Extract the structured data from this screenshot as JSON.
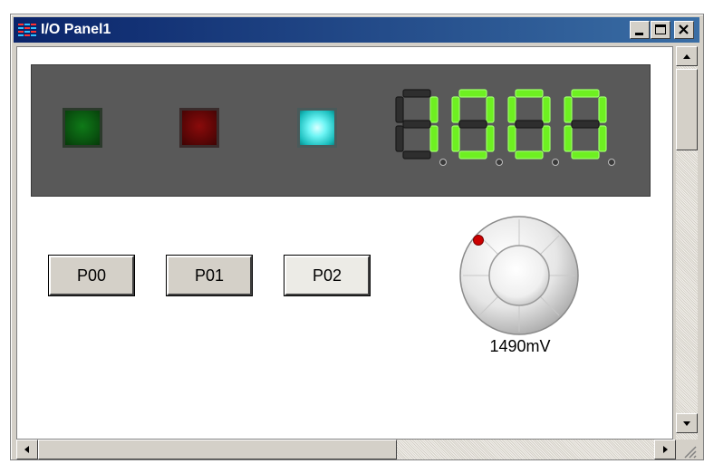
{
  "window": {
    "title": "I/O Panel1",
    "icon": "io-panel-app-icon",
    "controls": [
      "minimize-icon",
      "maximize-icon",
      "close-icon"
    ]
  },
  "display_panel": {
    "leds": [
      {
        "name": "led-1",
        "state": "off",
        "color": "#0a5510"
      },
      {
        "name": "led-2",
        "state": "off",
        "color": "#5e0606"
      },
      {
        "name": "led-3",
        "state": "on",
        "color": "#6ff5f5"
      }
    ],
    "seven_segment": {
      "digits": 4,
      "lit_segments": [
        [
          "b",
          "c"
        ],
        [
          "a",
          "b",
          "c",
          "d",
          "e",
          "f"
        ],
        [
          "a",
          "b",
          "c",
          "d",
          "e",
          "f"
        ],
        [
          "a",
          "b",
          "c",
          "d",
          "e",
          "f"
        ]
      ],
      "lit_color": "#6ef021",
      "unlit_color": "#2e2e2e"
    }
  },
  "buttons": [
    {
      "label": "P00"
    },
    {
      "label": "P01"
    },
    {
      "label": "P02"
    }
  ],
  "knob": {
    "readout": "1490mV",
    "indicator_color": "#cc0000"
  },
  "scrollbars": {
    "vertical": {
      "up_icon": "scroll-up-arrow-icon",
      "down_icon": "scroll-down-arrow-icon"
    },
    "horizontal": {
      "left_icon": "scroll-left-arrow-icon",
      "right_icon": "scroll-right-arrow-icon"
    }
  }
}
